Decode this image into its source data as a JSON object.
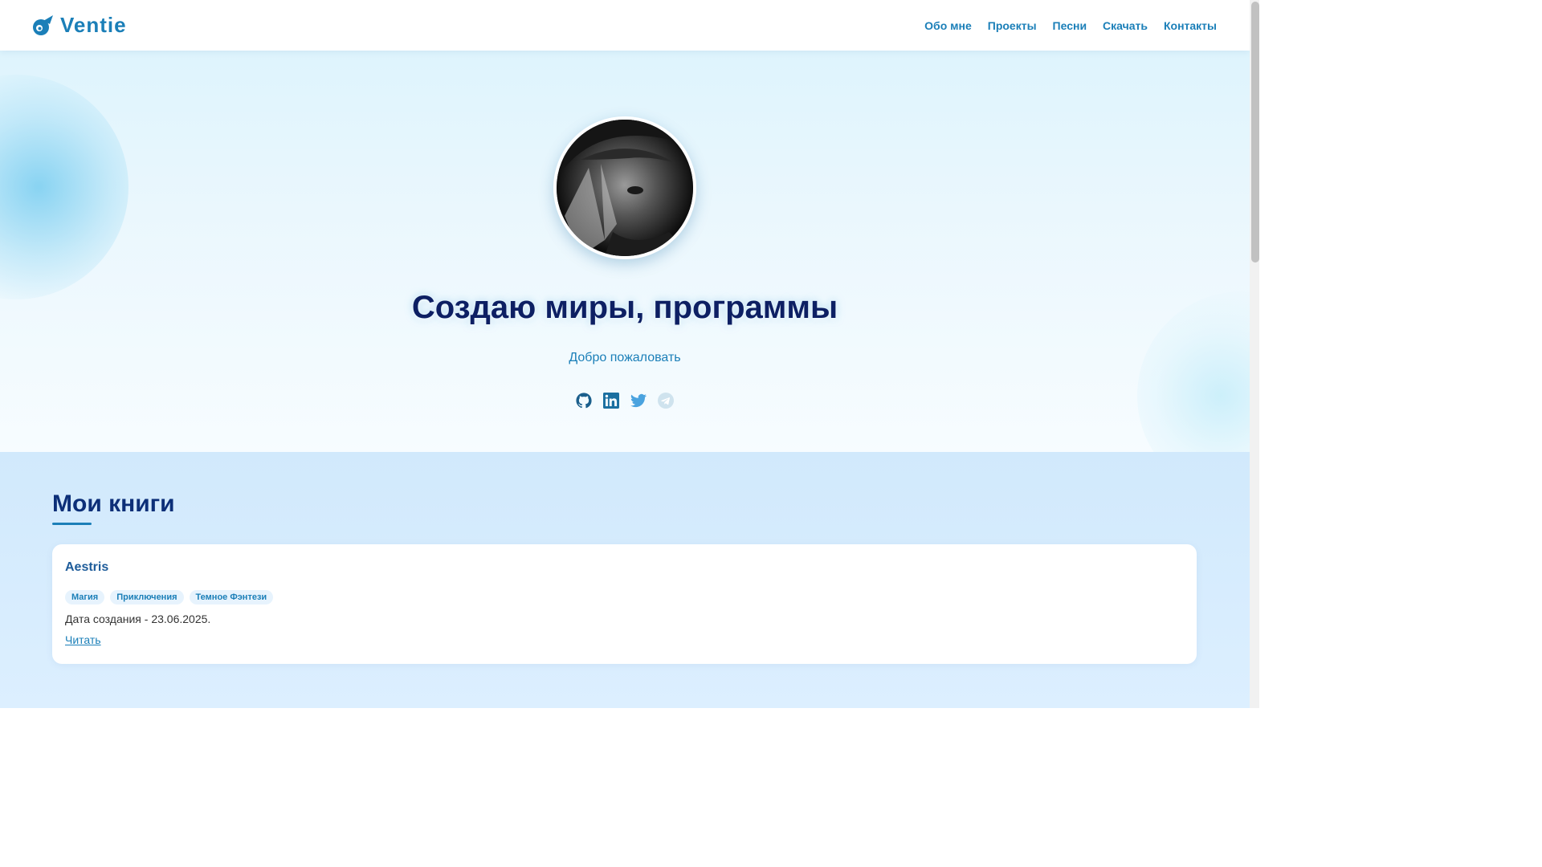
{
  "brand": {
    "name": "Ventie",
    "icon": "comet-icon",
    "color": "#1b7fb8"
  },
  "nav": {
    "items": [
      {
        "label": "Обо мне"
      },
      {
        "label": "Проекты"
      },
      {
        "label": "Песни"
      },
      {
        "label": "Скачать"
      },
      {
        "label": "Контакты"
      }
    ]
  },
  "hero": {
    "title": "Создаю миры, программы",
    "subtitle": "Добро пожаловать",
    "avatar_alt": "avatar",
    "socials": [
      {
        "icon": "github-icon",
        "color": "#1b5f8c"
      },
      {
        "icon": "linkedin-icon",
        "color": "#1b6fa0"
      },
      {
        "icon": "twitter-icon",
        "color": "#4aa3df"
      },
      {
        "icon": "telegram-icon",
        "color": "#cfe3ee"
      }
    ]
  },
  "books_section": {
    "title": "Мои книги",
    "books": [
      {
        "title": "Aestris",
        "tags": [
          "Магия",
          "Приключения",
          "Темное Фэнтези"
        ],
        "date": "Дата создания - 23.06.2025.",
        "link_label": "Читать"
      }
    ]
  }
}
